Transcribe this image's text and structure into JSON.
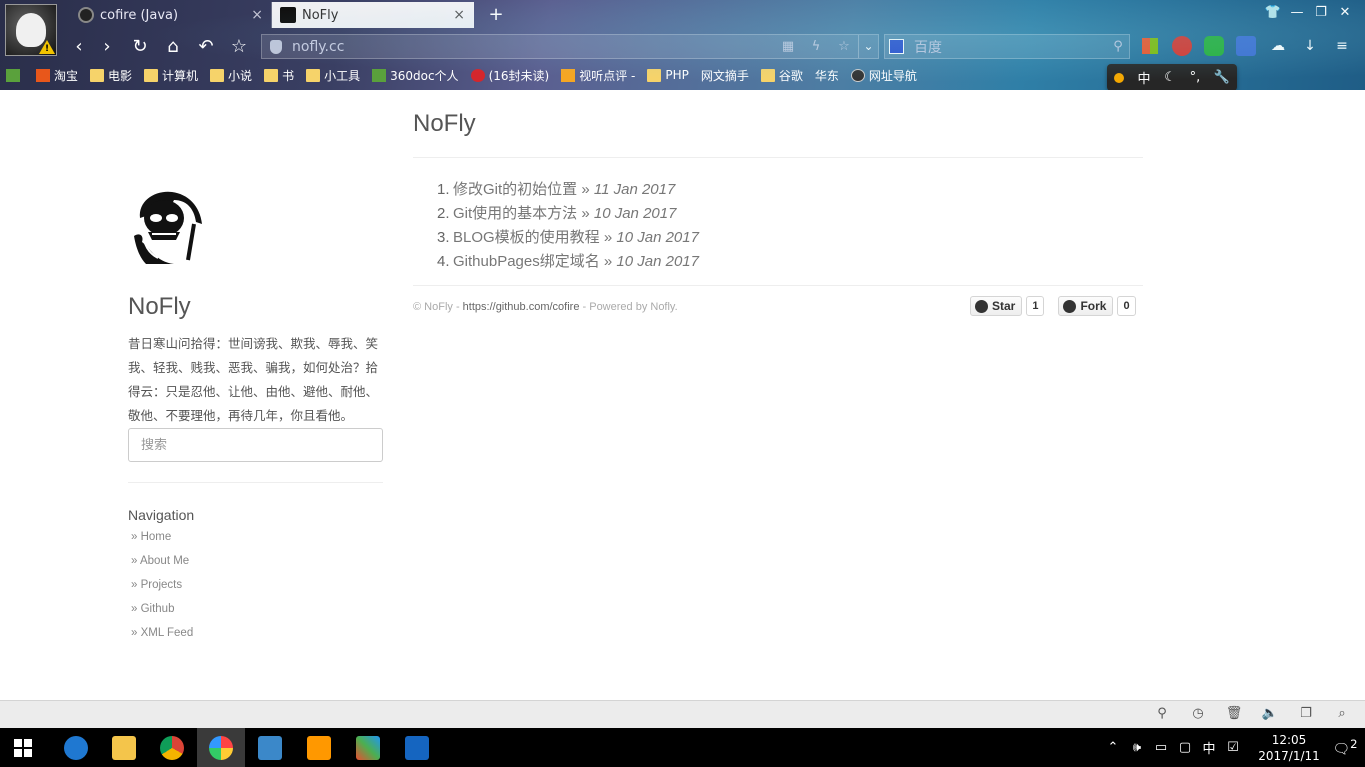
{
  "browser": {
    "tabs": [
      {
        "label": "cofire (Java)",
        "close": "×"
      },
      {
        "label": "NoFly",
        "close": "×"
      }
    ],
    "new_tab": "+",
    "url": "nofly.cc",
    "search_placeholder": "百度",
    "window_controls": [
      "👕",
      "—",
      "❐",
      "✕"
    ],
    "nav_buttons": [
      "‹",
      "›",
      "↻",
      "⌂",
      "↶",
      "☆"
    ],
    "bookmarks": [
      {
        "label": "",
        "icon": "ico-gr"
      },
      {
        "label": "淘宝",
        "icon": "ico-red"
      },
      {
        "label": "电影",
        "icon": "fold"
      },
      {
        "label": "计算机",
        "icon": "fold"
      },
      {
        "label": "小说",
        "icon": "fold"
      },
      {
        "label": "书",
        "icon": "fold"
      },
      {
        "label": "小工具",
        "icon": "fold"
      },
      {
        "label": "360doc个人",
        "icon": "ico-gr"
      },
      {
        "label": "(16封未读)",
        "icon": "ico-rr"
      },
      {
        "label": "视听点评 -",
        "icon": "ico-or"
      },
      {
        "label": "PHP",
        "icon": "fold"
      },
      {
        "label": "网文摘手",
        "icon": "page"
      },
      {
        "label": "谷歌",
        "icon": "fold"
      },
      {
        "label": "华东",
        "icon": "page"
      },
      {
        "label": "网址导航",
        "icon": "ico-dk"
      }
    ],
    "mini_panel": {
      "lang": "中"
    }
  },
  "sidebar": {
    "site_name": "NoFly",
    "description": "昔日寒山问拾得：世间谤我、欺我、辱我、笑我、轻我、贱我、恶我、骗我，如何处治？拾得云：只是忍他、让他、由他、避他、耐他、敬他、不要理他，再待几年，你且看他。",
    "search_placeholder": "搜索",
    "nav_title": "Navigation",
    "nav_items": [
      {
        "label": "» Home"
      },
      {
        "label": "» About Me"
      },
      {
        "label": "» Projects"
      },
      {
        "label": "» Github"
      },
      {
        "label": "» XML Feed"
      }
    ]
  },
  "main": {
    "title": "NoFly",
    "posts": [
      {
        "num": "1.",
        "title": "修改Git的初始位置",
        "sep": " » ",
        "date": "11 Jan 2017"
      },
      {
        "num": "2.",
        "title": "Git使用的基本方法",
        "sep": " » ",
        "date": "10 Jan 2017"
      },
      {
        "num": "3.",
        "title": "BLOG模板的使用教程",
        "sep": " » ",
        "date": "10 Jan 2017"
      },
      {
        "num": "4.",
        "title": "GithubPages绑定域名",
        "sep": " » ",
        "date": "10 Jan 2017"
      }
    ],
    "footer": {
      "prefix": "© NoFly - ",
      "link": "https://github.com/cofire",
      "suffix": " - Powered by Nofly."
    },
    "star": {
      "label": "Star",
      "count": "1"
    },
    "fork": {
      "label": "Fork",
      "count": "0"
    }
  },
  "taskbar": {
    "time": "12:05",
    "date": "2017/1/11",
    "ime": "中",
    "notifications": "2"
  },
  "colors": {
    "accent": "#555555",
    "link": "#777777",
    "muted": "#aaaaaa"
  }
}
